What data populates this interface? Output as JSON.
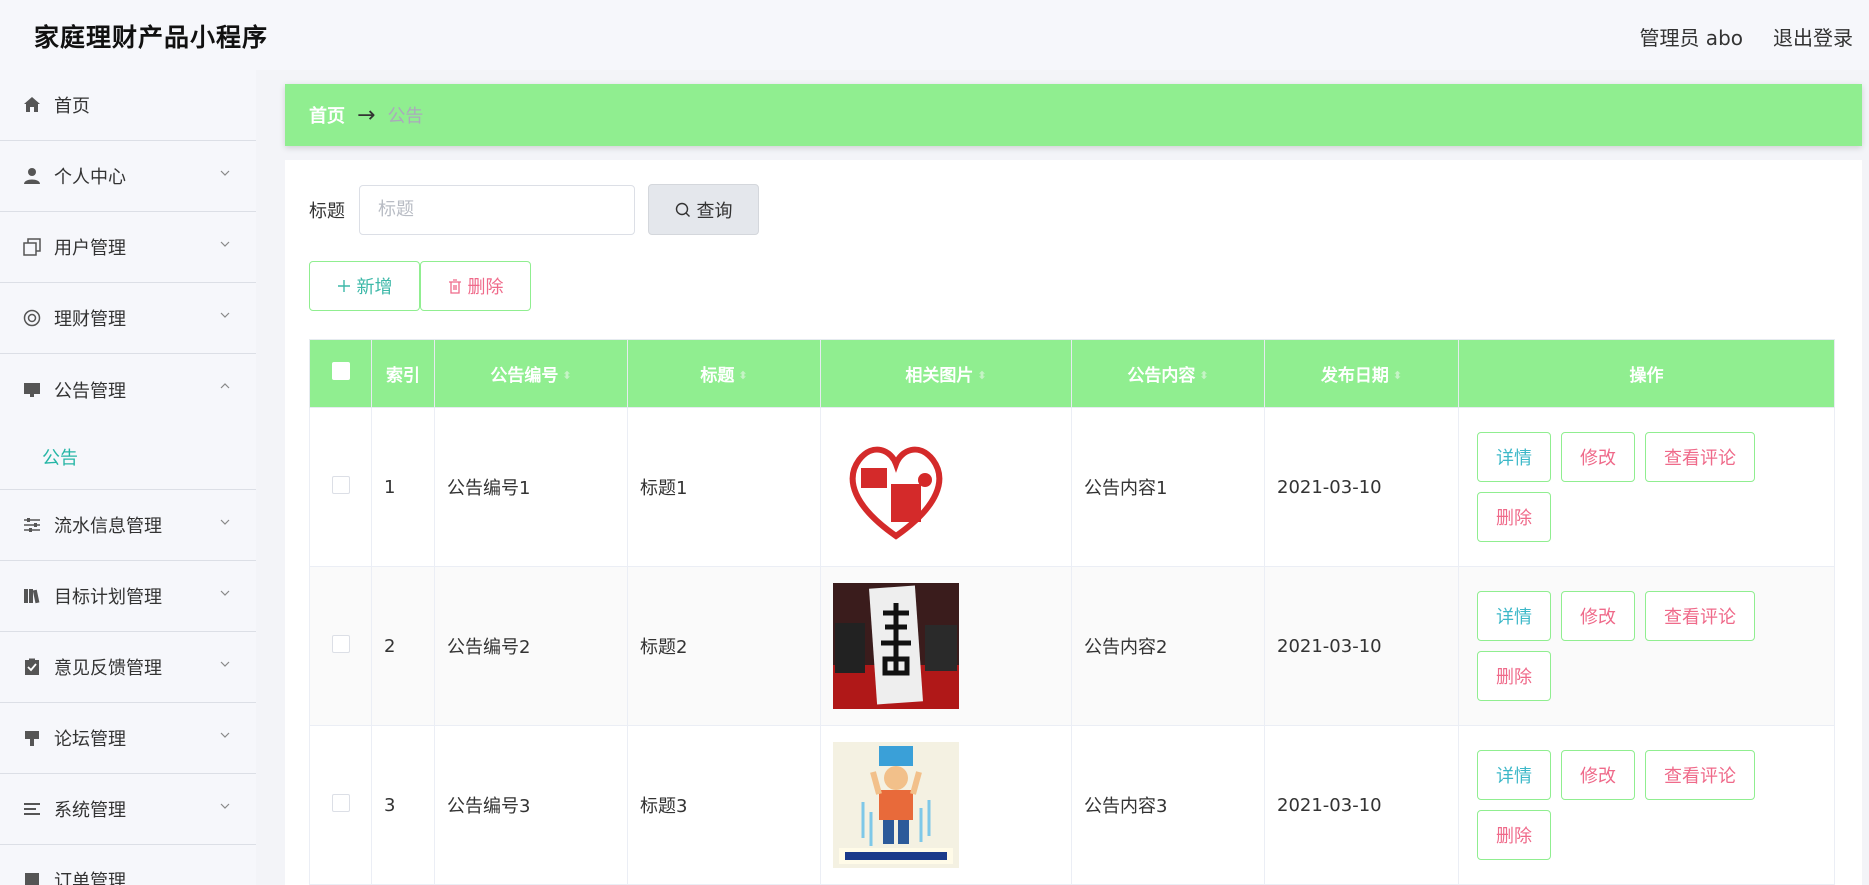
{
  "header": {
    "app_title": "家庭理财产品小程序",
    "user_label": "管理员 abo",
    "logout_label": "退出登录"
  },
  "sidebar": {
    "items": [
      {
        "label": "首页",
        "icon": "home-icon"
      },
      {
        "label": "个人中心",
        "icon": "user-icon"
      },
      {
        "label": "用户管理",
        "icon": "copy-icon"
      },
      {
        "label": "理财管理",
        "icon": "lifebuoy-icon"
      },
      {
        "label": "公告管理",
        "icon": "monitor-icon"
      },
      {
        "label": "流水信息管理",
        "icon": "sliders-icon"
      },
      {
        "label": "目标计划管理",
        "icon": "books-icon"
      },
      {
        "label": "意见反馈管理",
        "icon": "clipboard-check-icon"
      },
      {
        "label": "论坛管理",
        "icon": "brush-icon"
      },
      {
        "label": "系统管理",
        "icon": "list-icon"
      },
      {
        "label": "订单管理",
        "icon": "order-icon"
      }
    ],
    "submenu_label": "公告"
  },
  "breadcrumb": {
    "home": "首页",
    "separator": "→",
    "current": "公告"
  },
  "search": {
    "label": "标题",
    "placeholder": "标题",
    "value": "",
    "button_label": "查询"
  },
  "actions": {
    "add_label": "新增",
    "delete_label": "删除"
  },
  "table": {
    "headers": {
      "index": "索引",
      "code": "公告编号",
      "title": "标题",
      "image": "相关图片",
      "content": "公告内容",
      "date": "发布日期",
      "ops": "操作"
    },
    "rows": [
      {
        "index": "1",
        "code": "公告编号1",
        "title": "标题1",
        "image_desc": "heart-logo",
        "content": "公告内容1",
        "date": "2021-03-10"
      },
      {
        "index": "2",
        "code": "公告编号2",
        "title": "标题2",
        "image_desc": "calligraphy-photo",
        "content": "公告内容2",
        "date": "2021-03-10"
      },
      {
        "index": "3",
        "code": "公告编号3",
        "title": "标题3",
        "image_desc": "ice-bucket-poster",
        "content": "公告内容3",
        "date": "2021-03-10"
      }
    ],
    "op_labels": {
      "detail": "详情",
      "edit": "修改",
      "comment": "查看评论",
      "remove": "删除"
    }
  },
  "colors": {
    "accent": "#90ee90",
    "teal": "#26b6a6",
    "pink": "#ef6a8a"
  }
}
